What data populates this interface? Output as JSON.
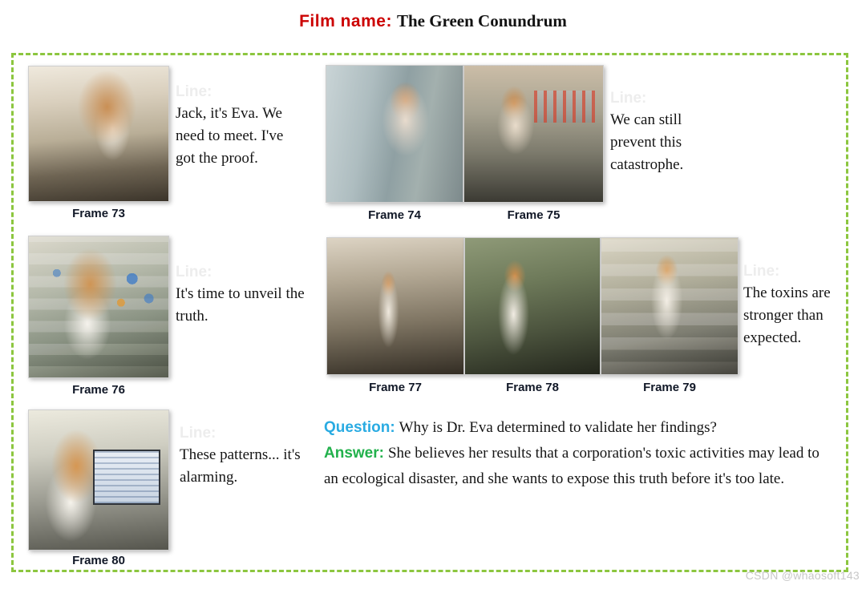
{
  "title": {
    "label": "Film name:",
    "value": "The Green Conundrum",
    "label_color": "#CC0000",
    "value_color": "#121212"
  },
  "container": {
    "border_color": "#8CC63F",
    "border_style": "dashed"
  },
  "line_label": "Line:",
  "groups": [
    {
      "id": "group-1",
      "frames": [
        {
          "caption": "Frame 73"
        }
      ],
      "line": "Jack, it's Eva. We need to meet. I've got the proof."
    },
    {
      "id": "group-2",
      "frames": [
        {
          "caption": "Frame 74"
        },
        {
          "caption": "Frame 75"
        }
      ],
      "line": "We can still prevent this catastrophe."
    },
    {
      "id": "group-3",
      "frames": [
        {
          "caption": "Frame 76"
        }
      ],
      "line": "It's time to unveil the truth."
    },
    {
      "id": "group-4",
      "frames": [
        {
          "caption": "Frame 77"
        },
        {
          "caption": "Frame 78"
        },
        {
          "caption": "Frame 79"
        }
      ],
      "line": "The toxins are stronger than expected."
    },
    {
      "id": "group-5",
      "frames": [
        {
          "caption": "Frame 80"
        }
      ],
      "line": "These patterns... it's alarming."
    }
  ],
  "qa": {
    "question_label": "Question:",
    "question_color": "#29ABE2",
    "question_text": "Why is Dr. Eva determined to validate her findings?",
    "answer_label": "Answer:",
    "answer_color": "#22B14C",
    "answer_text": "She believes her results that a corporation's toxic activities may lead to an ecological disaster, and she wants to expose this truth before it's too late."
  },
  "watermark": "CSDN @whaosoft143"
}
